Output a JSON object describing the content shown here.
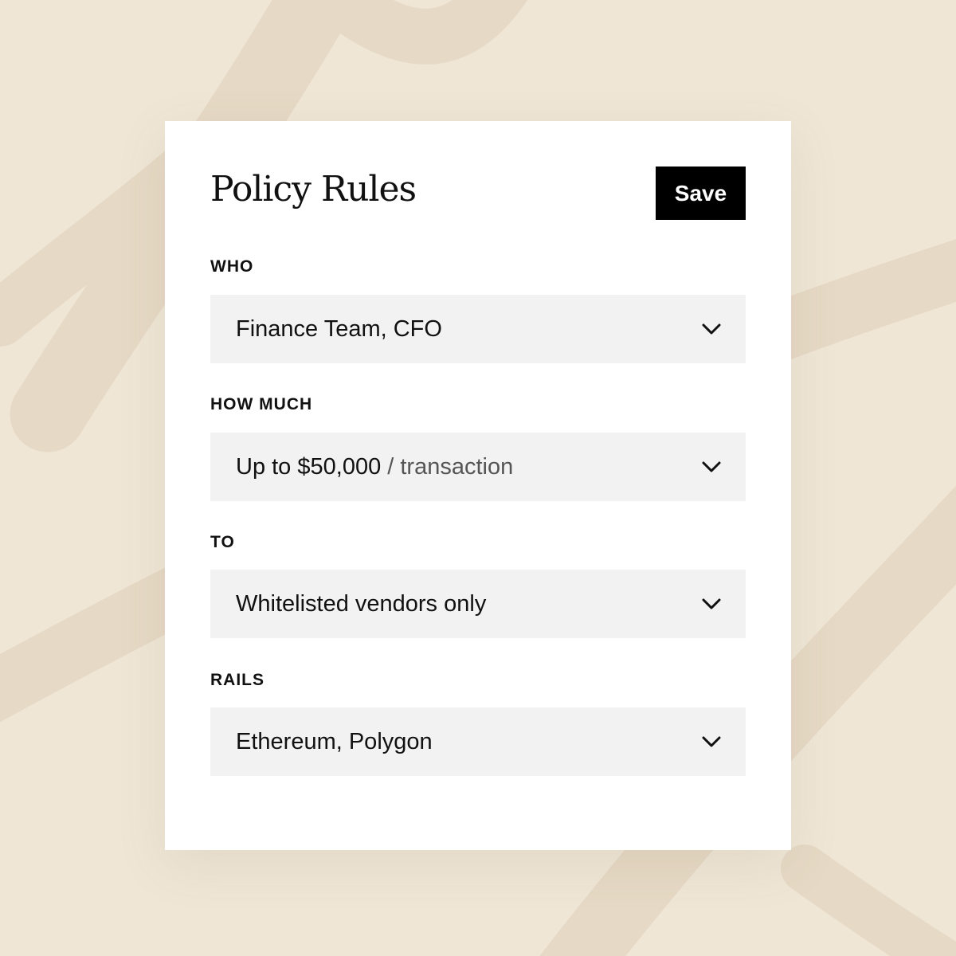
{
  "panel": {
    "title": "Policy Rules",
    "save_label": "Save"
  },
  "fields": [
    {
      "label": "WHO",
      "value": "Finance Team, CFO",
      "suffix": ""
    },
    {
      "label": "HOW MUCH",
      "value": "Up to $50,000",
      "suffix": " / transaction"
    },
    {
      "label": "TO",
      "value": "Whitelisted vendors only",
      "suffix": ""
    },
    {
      "label": "RAILS",
      "value": "Ethereum, Polygon",
      "suffix": ""
    }
  ],
  "icons": {
    "dropdown": "chevron-down-icon"
  },
  "colors": {
    "background": "#efe6d6",
    "brush_strokes": "#e6d9c5",
    "card": "#ffffff",
    "field_background": "#f2f2f2",
    "button": "#000000",
    "button_text": "#ffffff",
    "text": "#111111",
    "muted_text": "#555555"
  }
}
